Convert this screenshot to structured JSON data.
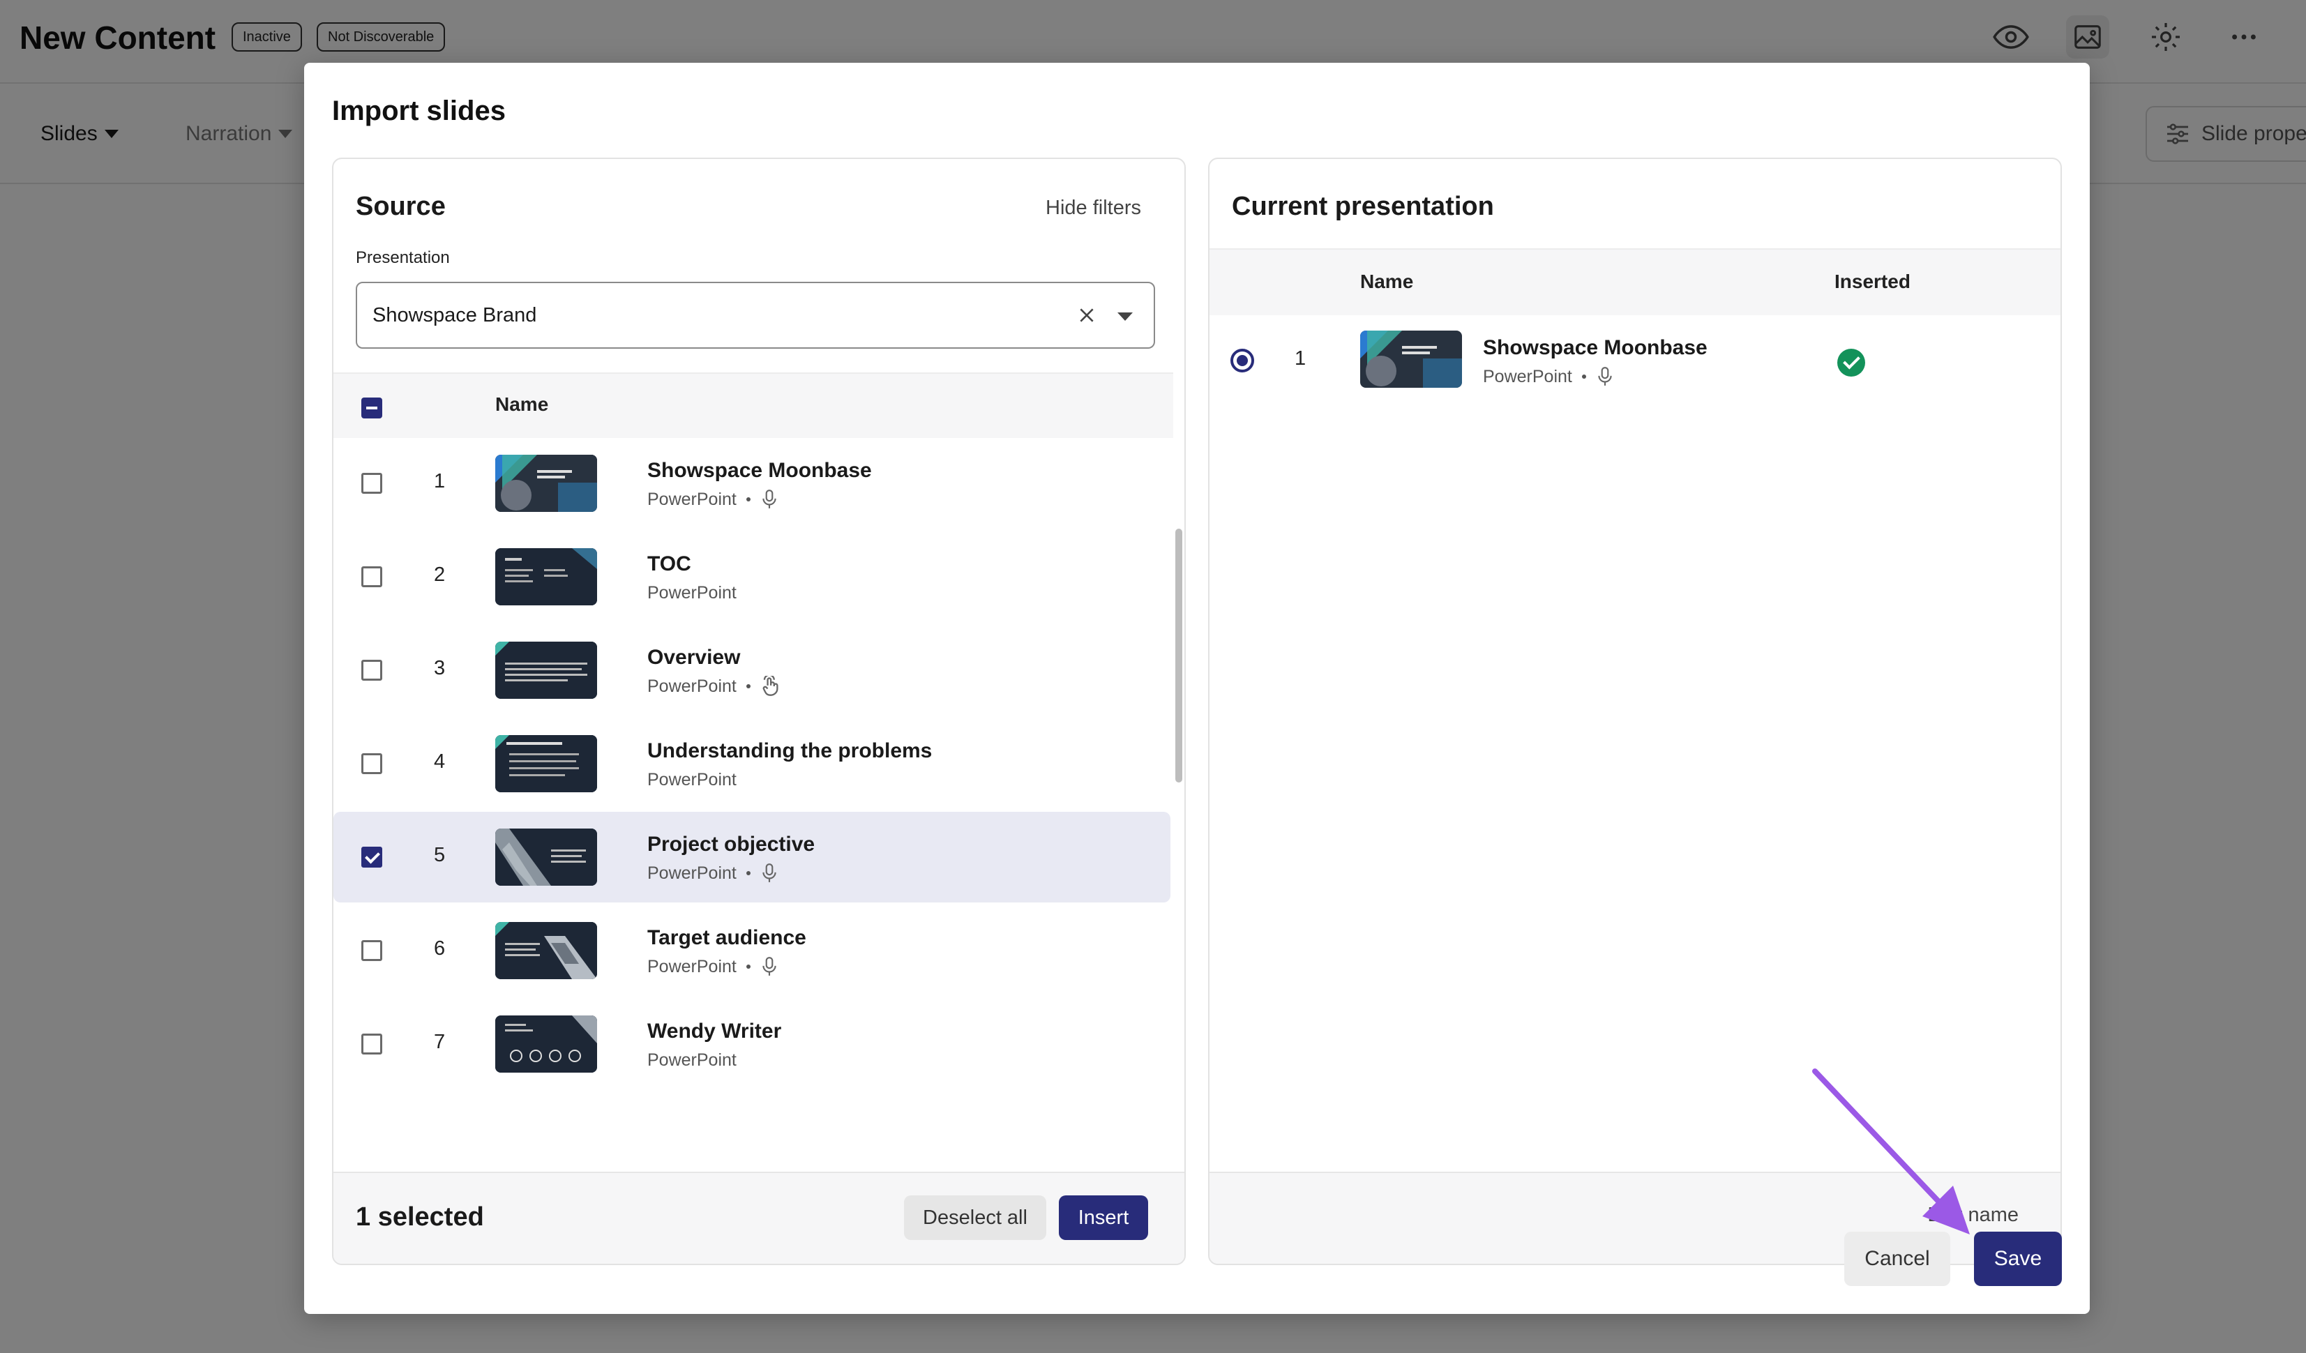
{
  "app": {
    "title": "New Content",
    "badges": [
      "Inactive",
      "Not Discoverable"
    ],
    "icons": [
      "eye-icon",
      "image-icon",
      "gear-icon",
      "more-icon"
    ],
    "toolbar": {
      "tabs": [
        "Slides",
        "Narration"
      ],
      "slide_properties": "Slide prope"
    }
  },
  "modal": {
    "title": "Import slides",
    "source": {
      "heading": "Source",
      "hide_filters": "Hide filters",
      "presentation_label": "Presentation",
      "presentation_value": "Showspace Brand",
      "column_name": "Name",
      "slides": [
        {
          "num": "1",
          "name": "Showspace Moonbase",
          "type": "PowerPoint",
          "extra_icon": "microphone-icon",
          "checked": false
        },
        {
          "num": "2",
          "name": "TOC",
          "type": "PowerPoint",
          "extra_icon": "",
          "checked": false
        },
        {
          "num": "3",
          "name": "Overview",
          "type": "PowerPoint",
          "extra_icon": "touch-icon",
          "checked": false
        },
        {
          "num": "4",
          "name": "Understanding the problems",
          "type": "PowerPoint",
          "extra_icon": "",
          "checked": false
        },
        {
          "num": "5",
          "name": "Project objective",
          "type": "PowerPoint",
          "extra_icon": "microphone-icon",
          "checked": true
        },
        {
          "num": "6",
          "name": "Target audience",
          "type": "PowerPoint",
          "extra_icon": "microphone-icon",
          "checked": false
        },
        {
          "num": "7",
          "name": "Wendy Writer",
          "type": "PowerPoint",
          "extra_icon": "",
          "checked": false
        }
      ],
      "footer": {
        "selected_count": "1 selected",
        "deselect_all": "Deselect all",
        "insert": "Insert"
      }
    },
    "current": {
      "heading": "Current presentation",
      "column_name": "Name",
      "column_inserted": "Inserted",
      "slides": [
        {
          "num": "1",
          "name": "Showspace Moonbase",
          "type": "PowerPoint",
          "extra_icon": "microphone-icon",
          "inserted": true
        }
      ],
      "edit_name": "Edit name"
    },
    "actions": {
      "cancel": "Cancel",
      "save": "Save"
    }
  },
  "colors": {
    "primary": "#282c7a",
    "selected_row": "#e8e9f3",
    "success": "#13925a",
    "annotation_arrow": "#9b59e6"
  }
}
